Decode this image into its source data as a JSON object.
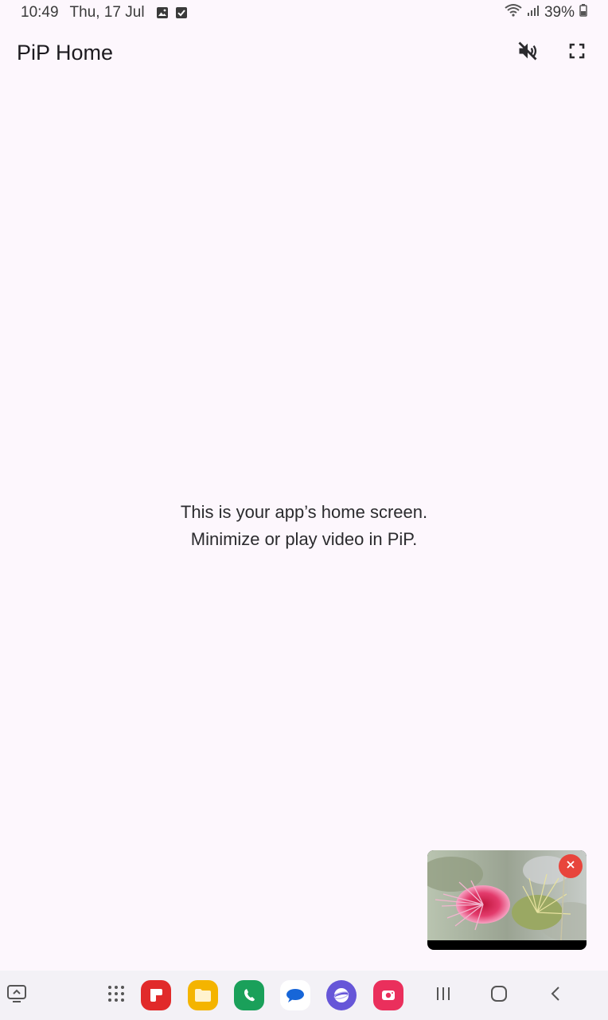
{
  "status_bar": {
    "time": "10:49",
    "date": "Thu, 17 Jul",
    "battery": "39%"
  },
  "app_bar": {
    "title": "PiP Home"
  },
  "main": {
    "line1": "This is your app’s home screen.",
    "line2": "Minimize or play video in PiP."
  },
  "colors": {
    "background": "#fdf7fd",
    "pip_close": "#e8453c",
    "taskbar": "#f3f1f6"
  },
  "taskbar": {
    "apps": [
      "Flipboard",
      "My Files",
      "Phone",
      "Messages",
      "Internet",
      "Screen Recorder"
    ]
  }
}
